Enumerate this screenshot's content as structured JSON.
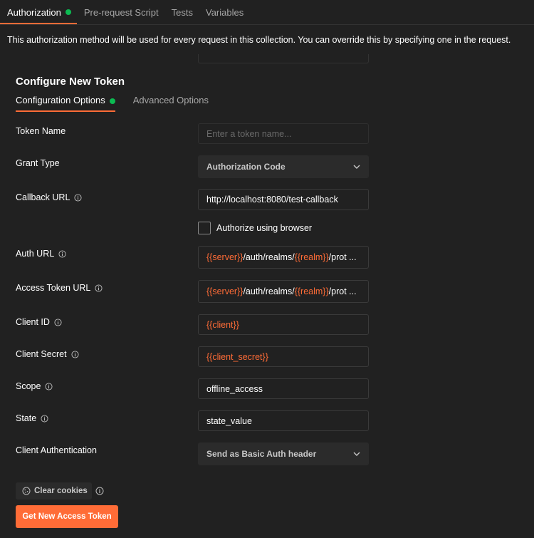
{
  "tabs": [
    {
      "label": "Authorization",
      "active": true,
      "dot": true
    },
    {
      "label": "Pre-request Script"
    },
    {
      "label": "Tests"
    },
    {
      "label": "Variables"
    }
  ],
  "description": "This authorization method will be used for every request in this collection. You can override this by specifying one in the request.",
  "section_title": "Configure New Token",
  "subtabs": [
    {
      "label": "Configuration Options",
      "active": true,
      "dot": true
    },
    {
      "label": "Advanced Options"
    }
  ],
  "fields": {
    "token_name": {
      "label": "Token Name",
      "value": "",
      "placeholder": "Enter a token name..."
    },
    "grant_type": {
      "label": "Grant Type",
      "value": "Authorization Code"
    },
    "callback_url": {
      "label": "Callback URL",
      "value": "http://localhost:8080/test-callback"
    },
    "authorize_browser": {
      "label": "Authorize using browser",
      "checked": false
    },
    "auth_url": {
      "label": "Auth URL",
      "var1": "{{server}}",
      "mid": "/auth/realms/",
      "var2": "{{realm}}",
      "tail": "/prot ..."
    },
    "access_token_url": {
      "label": "Access Token URL",
      "var1": "{{server}}",
      "mid": "/auth/realms/",
      "var2": "{{realm}}",
      "tail": "/prot ..."
    },
    "client_id": {
      "label": "Client ID",
      "value": "{{client}}"
    },
    "client_secret": {
      "label": "Client Secret",
      "value": "{{client_secret}}"
    },
    "scope": {
      "label": "Scope",
      "value": "offline_access"
    },
    "state": {
      "label": "State",
      "value": "state_value"
    },
    "client_auth": {
      "label": "Client Authentication",
      "value": "Send as Basic Auth header"
    }
  },
  "buttons": {
    "clear_cookies": "Clear cookies",
    "get_token": "Get New Access Token"
  },
  "colors": {
    "accent": "#ff6c37",
    "status_dot": "#0cbb52",
    "background": "#212121"
  },
  "icons": [
    "info-icon",
    "chevron-down-icon",
    "cookie-icon"
  ]
}
